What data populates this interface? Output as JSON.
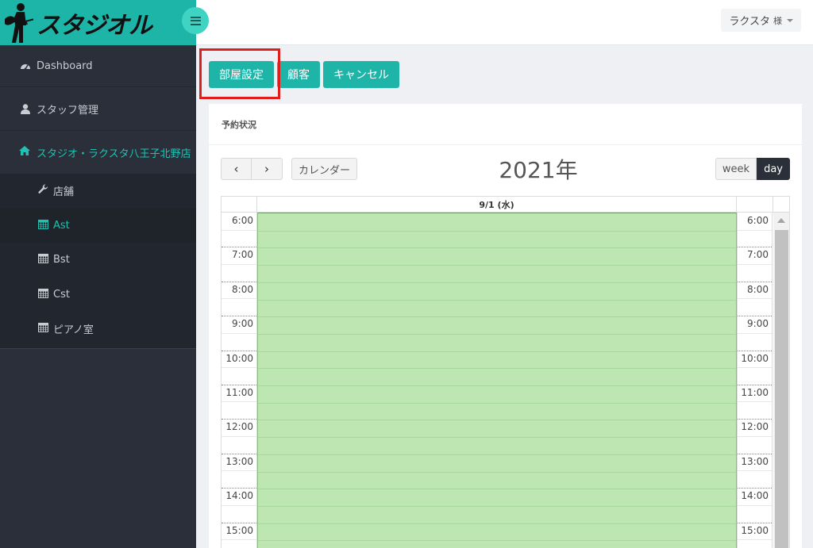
{
  "brand": {
    "logo_text": "スタジオル",
    "accent_color": "#1cb5a8"
  },
  "sidebar": {
    "items": [
      {
        "label": "Dashboard",
        "icon": "dashboard-icon"
      },
      {
        "label": "スタッフ管理",
        "icon": "user-icon"
      }
    ],
    "store": {
      "label": "スタジオ・ラクスタ八王子北野店",
      "icon": "home-icon"
    },
    "sub_items": [
      {
        "label": "店舗",
        "icon": "wrench-icon"
      },
      {
        "label": "Ast",
        "icon": "calendar-icon",
        "active": true
      },
      {
        "label": "Bst",
        "icon": "calendar-icon"
      },
      {
        "label": "Cst",
        "icon": "calendar-icon"
      },
      {
        "label": "ピアノ室",
        "icon": "calendar-icon"
      }
    ]
  },
  "topbar": {
    "user_name": "ラクスタ",
    "user_suffix": "様"
  },
  "actions": {
    "room_settings": "部屋設定",
    "customers": "顧客",
    "cancel": "キャンセル"
  },
  "panel": {
    "title": "予約状況"
  },
  "calendar": {
    "prev": "‹",
    "next": "›",
    "calendar_button": "カレンダー",
    "title": "2021年",
    "view_week": "week",
    "view_day": "day",
    "active_view": "day",
    "day_header": "9/1 (水)",
    "hours": [
      "6:00",
      "7:00",
      "8:00",
      "9:00",
      "10:00",
      "11:00",
      "12:00",
      "13:00",
      "14:00",
      "15:00"
    ],
    "available_color": "#bee6b3"
  }
}
